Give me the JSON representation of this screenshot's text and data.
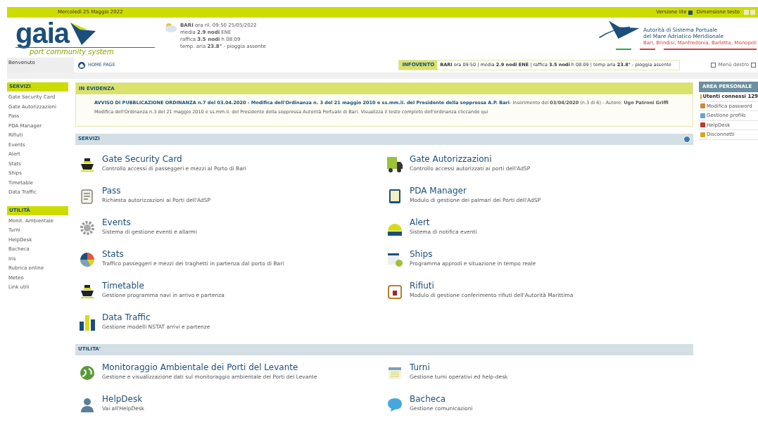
{
  "top_bar": {
    "date": "Mercoledì 25 Maggio 2022",
    "lite_version": "Versione lite",
    "text_size": "Dimensione testo"
  },
  "logo": {
    "name": "gaia",
    "tagline": "port community system"
  },
  "weather": [
    "**BARI** ora ril. 09:50 25/05/2022",
    "media **2.9 nodi** ENE",
    "raffica **3.5 nodi** h 08:09",
    "temp. aria **23.8°** - pioggia assente"
  ],
  "authority": {
    "line1": "Autorità di Sistema Portuale",
    "line2": "del Mare Adriatico Meridionale",
    "ports": "Bari, Brindisi, Manfredonia, Barletta, Monopoli"
  },
  "welcome": "Benvenuto",
  "home": "HOME PAGE",
  "infovento": {
    "label": "INFOVENTO",
    "text": "**BARI** ora 09:50 | media **2.9 nodi ENE** | raffica **3.5 nodi** h 08:09 | temp aria **23.8°** - pioggia assente"
  },
  "right_menu": "Menù destro",
  "sidebar": [
    {
      "title": "SERVIZI",
      "items": [
        "Gate Security Card",
        "Gate Autorizzazioni",
        "Pass",
        "PDA Manager",
        "Rifiuti",
        "Events",
        "Alert",
        "Stats",
        "Ships",
        "Timetable",
        "Data Traffic"
      ]
    },
    {
      "title": "UTILITÀ",
      "items": [
        "Monit. Ambientale",
        "Turni",
        "HelpDesk",
        "Bacheca",
        "Iris",
        "Rubrica online",
        "Meteo",
        "Link utili"
      ]
    }
  ],
  "highlight": {
    "title": "IN EVIDENZA",
    "link": "AVVISO DI PUBBLICAZIONE ORDINANZA n.7 del 03.04.2020 - Modifica dell'Ordinanza n. 3 del 21 maggio 2010 e ss.mm.ii. del Presidente della soppressa A.P. Bari",
    "meta": " - Inserimento del **03/04/2020** (n.3 di 6) - Autore: **Ugo Patroni Griffi**",
    "text": "Modifica dell'Ordinanza n.3 del 21 maggio 2010 e ss.mm.ii. del Presidente della soppressa Autorità Portuale di Bari. Visualizza il testo completo dell'ordinanza cliccando qui"
  },
  "services": {
    "title": "SERVIZI",
    "items": [
      {
        "title": "Gate Security Card",
        "desc": "Controllo accessi di passeggeri e mezzi al Porto di Bari"
      },
      {
        "title": "Gate Autorizzazioni",
        "desc": "Controllo accessi autorizzati ai porti dell'AdSP"
      },
      {
        "title": "Pass",
        "desc": "Richiesta autorizzazioni ai Porti dell'AdSP"
      },
      {
        "title": "PDA Manager",
        "desc": "Modulo di gestione dei palmari dei Porti dell'AdSP"
      },
      {
        "title": "Events",
        "desc": "Sistema di gestione eventi e allarmi"
      },
      {
        "title": "Alert",
        "desc": "Sistema di notifica eventi"
      },
      {
        "title": "Stats",
        "desc": "Traffico passeggeri e mezzi dei traghetti in partenza dal porto di Bari"
      },
      {
        "title": "Ships",
        "desc": "Programma approdi e situazione in tempo reale"
      },
      {
        "title": "Timetable",
        "desc": "Gestione programma navi in arrivo e partenza"
      },
      {
        "title": "Rifiuti",
        "desc": "Modulo di gestione conferimento rifiuti dell'Autorità Marittima"
      },
      {
        "title": "Data Traffic",
        "desc": "Gestione modelli NSTAT arrivi e partenze"
      }
    ]
  },
  "utilities": {
    "title": "UTILITA'",
    "items": [
      {
        "title": "Monitoraggio Ambientale dei Porti del Levante",
        "desc": "Gestione e visualizzazione dati sul monitoraggio ambientale dei Porti del Levante"
      },
      {
        "title": "Turni",
        "desc": "Gestione turni operativi ed help-desk"
      },
      {
        "title": "HelpDesk",
        "desc": "Vai all'HelpDesk"
      },
      {
        "title": "Bacheca",
        "desc": "Gestione comunicazioni"
      }
    ]
  },
  "personal": {
    "title": "AREA PERSONALE",
    "items": [
      "Utenti connessi 129",
      "Modifica password",
      "Gestione profilo",
      "HelpDesk",
      "Disconnetti"
    ]
  }
}
